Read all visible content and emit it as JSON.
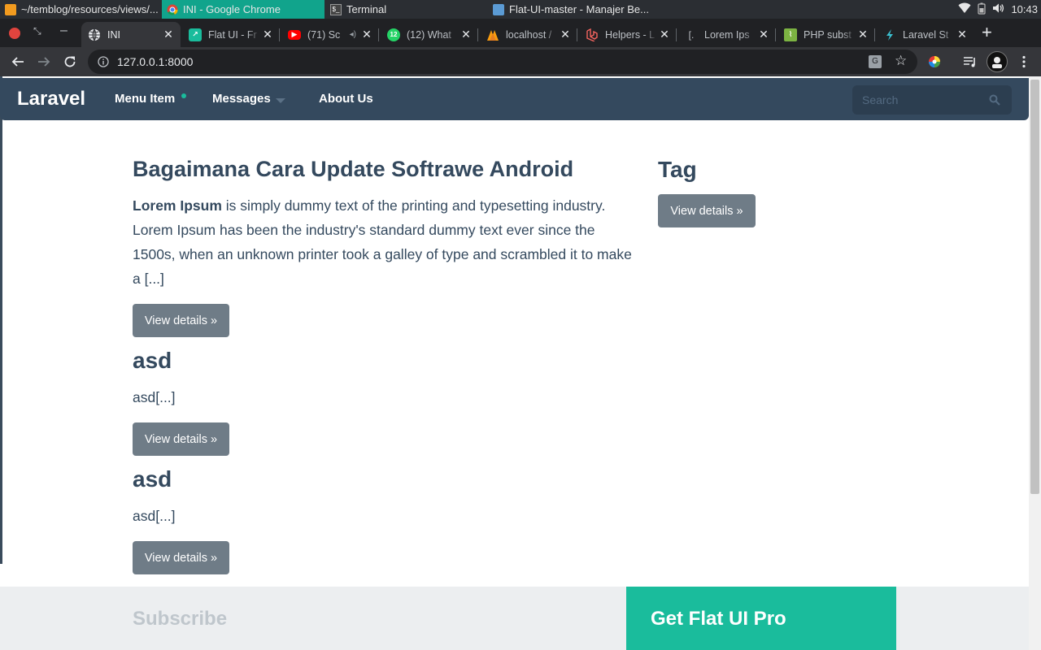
{
  "os": {
    "tasks": [
      {
        "title": "~/temblog/resources/views/..."
      },
      {
        "title": "INI - Google Chrome"
      },
      {
        "title": "Terminal"
      },
      {
        "title": "Flat-UI-master - Manajer Be..."
      }
    ],
    "clock": "10:43"
  },
  "browser": {
    "tabs": [
      {
        "title": "INI",
        "favicon": "globe-icon"
      },
      {
        "title": "Flat UI - Fr",
        "favicon": "flat-ui-icon"
      },
      {
        "title": "(71) Sc",
        "favicon": "youtube-icon"
      },
      {
        "title": "(12) What",
        "favicon": "whatsapp-icon",
        "badge": "12"
      },
      {
        "title": "localhost /",
        "favicon": "phpmyadmin-icon"
      },
      {
        "title": "Helpers - L",
        "favicon": "laravel-icon"
      },
      {
        "title": "Lorem Ips",
        "favicon": "lorem-icon"
      },
      {
        "title": "PHP subst",
        "favicon": "php-icon"
      },
      {
        "title": "Laravel St",
        "favicon": "laravel-studio-icon"
      }
    ],
    "url": "127.0.0.1:8000"
  },
  "site": {
    "brand": "Laravel",
    "nav": {
      "menu_item": "Menu Item",
      "messages": "Messages",
      "about": "About Us",
      "search_placeholder": "Search"
    },
    "posts": [
      {
        "title": "Bagaimana Cara Update Softrawe Android",
        "body_bold": "Lorem Ipsum",
        "body_rest": " is simply dummy text of the printing and typesetting industry. Lorem Ipsum has been the industry's standard dummy text ever since the 1500s, when an unknown printer took a galley of type and scrambled it to make a [...]",
        "button": "View details »"
      },
      {
        "title": "asd",
        "body": "asd[...]",
        "button": "View details »"
      },
      {
        "title": "asd",
        "body": "asd[...]",
        "button": "View details »"
      }
    ],
    "sidebar": {
      "title": "Tag",
      "button": "View details »"
    },
    "footer": {
      "subscribe": "Subscribe",
      "pro": "Get Flat UI Pro"
    },
    "colors": {
      "navbar": "#34495e",
      "accent": "#1abc9c",
      "button": "#6f7c87"
    }
  }
}
